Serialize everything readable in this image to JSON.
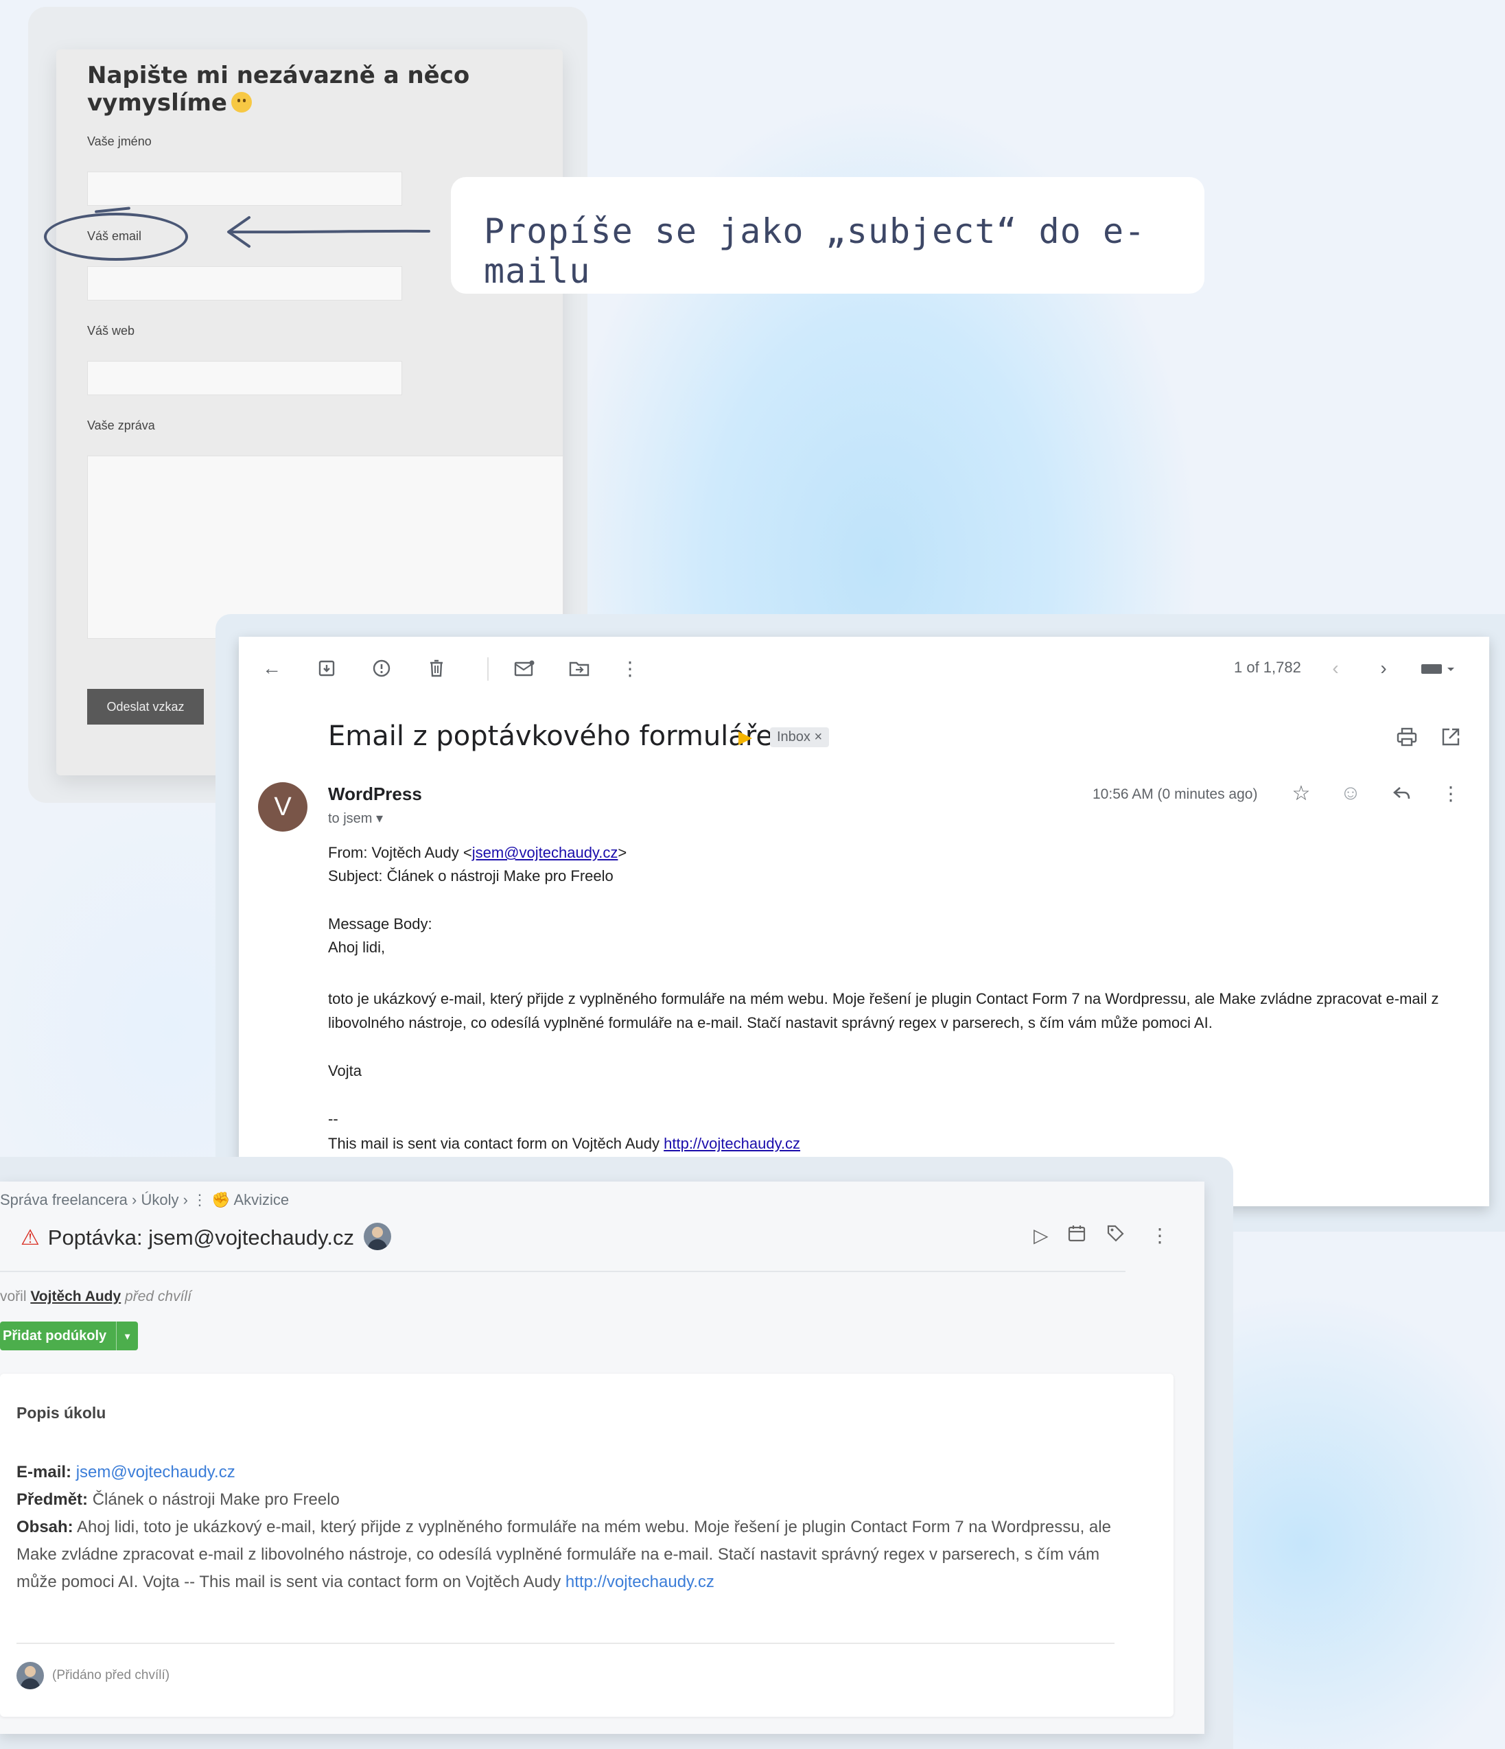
{
  "form": {
    "title": "Napište mi nezávazně a něco vymyslíme",
    "name_label": "Vaše jméno",
    "email_label": "Váš email",
    "web_label": "Váš web",
    "message_label": "Vaše zpráva",
    "submit_label": "Odeslat vzkaz"
  },
  "callout": {
    "text": "Propíše se jako „subject“ do e-mailu"
  },
  "gmail": {
    "counter": "1 of 1,782",
    "subject": "Email z poptávkového formuláře",
    "label_inbox": "Inbox ×",
    "avatar_letter": "V",
    "sender": "WordPress",
    "to": "to jsem ▾",
    "time": "10:56 AM (0 minutes ago)",
    "from_prefix": "From: Vojtěch Audy <",
    "from_email": "jsem@vojtechaudy.cz",
    "from_suffix": ">",
    "subject_line": "Subject: Článek o nástroji Make pro Freelo",
    "message_body_label": "Message Body:",
    "greeting": "Ahoj lidi,",
    "paragraph": "toto je ukázkový e-mail, který přijde z vyplněného formuláře na mém webu. Moje řešení je plugin Contact Form 7 na Wordpressu, ale Make zvládne zpracovat e-mail z libovolného nástroje, co odesílá vyplněné formuláře na e-mail. Stačí nastavit správný regex v parserech, s čím vám může pomoci AI.",
    "signature": "Vojta",
    "dashes": "--",
    "footer_text": "This mail is sent via contact form on Vojtěch Audy ",
    "footer_link": "http://vojtechaudy.cz"
  },
  "freelo": {
    "breadcrumb_1": "Správa freelancera",
    "breadcrumb_2": "Úkoly",
    "breadcrumb_3": "Akvizice",
    "task_title": "Poptávka: jsem@vojtechaudy.cz",
    "meta_prefix": "vořil ",
    "meta_author": "Vojtěch Audy",
    "meta_suffix": " před chvílí",
    "add_subtasks": "Přidat podúkoly",
    "description_heading": "Popis úkolu",
    "email_label": "E-mail:",
    "email_value": "jsem@vojtechaudy.cz",
    "subject_label": "Předmět:",
    "subject_value": "Článek o nástroji Make pro Freelo",
    "content_label": "Obsah:",
    "content_value": "Ahoj lidi, toto je ukázkový e-mail, který přijde z vyplněného formuláře na mém webu. Moje řešení je plugin Contact Form 7 na Wordpressu, ale Make zvládne zpracovat e-mail z libovolného nástroje, co odesílá vyplněné formuláře na e-mail. Stačí nastavit správný regex v parserech, s čím vám může pomoci AI. Vojta -- This mail is sent via contact form on Vojtěch Audy ",
    "content_link": "http://vojtechaudy.cz",
    "added_note": "(Přidáno před chvílí)"
  },
  "colors": {
    "accent_arrow": "#4a5775",
    "gmail_important": "#f4b400",
    "freelo_green": "#4cae4c",
    "warning_red": "#d93025"
  }
}
